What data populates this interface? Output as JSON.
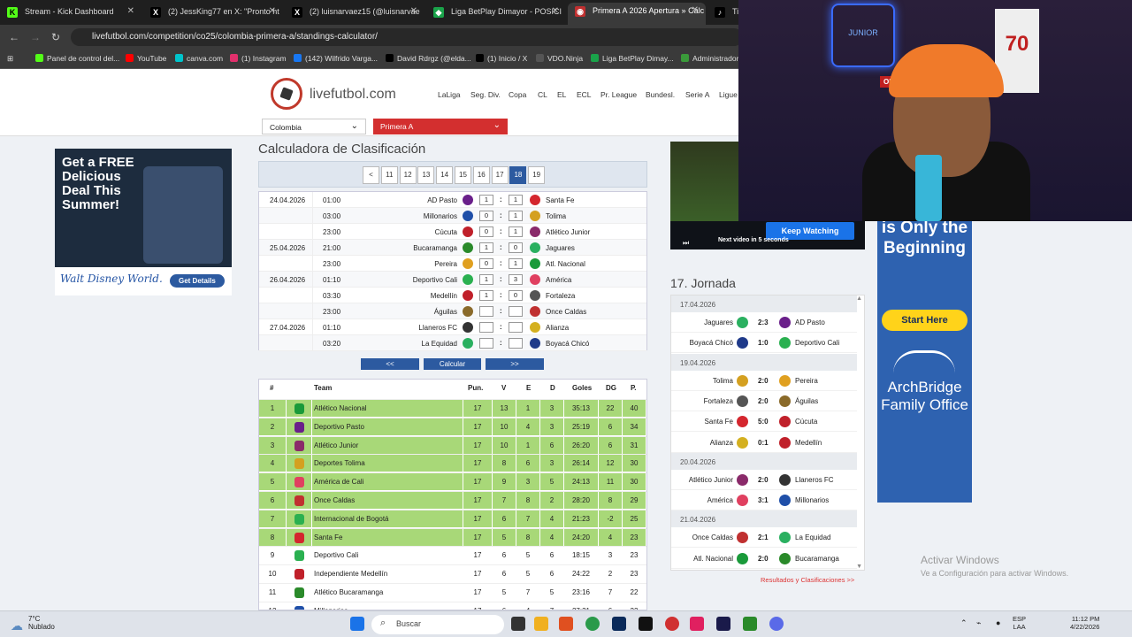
{
  "browser": {
    "tabs": [
      {
        "label": "Stream - Kick Dashboard",
        "icon": "K"
      },
      {
        "label": "(2) JessKing77 en X: \"Pronto ht",
        "icon": "X"
      },
      {
        "label": "(2) luisnarvaez15 (@luisnarvae",
        "icon": "X"
      },
      {
        "label": "Liga BetPlay Dimayor - POSICI",
        "icon": "◆"
      },
      {
        "label": "Primera A 2026 Apertura » Calc",
        "icon": "◉"
      },
      {
        "label": "Tik",
        "icon": "♪"
      }
    ],
    "url": "livefutbol.com/competition/co25/colombia-primera-a/standings-calculator/",
    "bookmarks": [
      "Panel de control del...",
      "YouTube",
      "canva.com",
      "(1) Instagram",
      "(142) Wilfrido Varga...",
      "David Rdrgz (@elda...",
      "(1) Inicio / X",
      "VDO.Ninja",
      "Liga BetPlay Dimay...",
      "Administrador"
    ]
  },
  "site": {
    "logo_text": "livefutbol.com",
    "nav": [
      "LaLiga",
      "Seg. Div.",
      "Copa",
      "CL",
      "EL",
      "ECL",
      "Pr. League",
      "Bundesl.",
      "Serie A",
      "Ligue"
    ],
    "country_select": "Colombia",
    "league_select": "Primera A"
  },
  "calculator": {
    "title": "Calculadora de Clasificación",
    "pages": [
      "<",
      "11",
      "12",
      "13",
      "14",
      "15",
      "16",
      "17",
      "18",
      "19"
    ],
    "active_page": "18",
    "matches": [
      {
        "date": "24.04.2026",
        "time": "01:00",
        "home": "AD Pasto",
        "hs": "1",
        "as": "1",
        "away": "Santa Fe",
        "hc": "#6a1f8a",
        "ac": "#d4262e"
      },
      {
        "date": "",
        "time": "03:00",
        "home": "Millonarios",
        "hs": "0",
        "as": "1",
        "away": "Tolima",
        "hc": "#1f4fa8",
        "ac": "#d4a020"
      },
      {
        "date": "",
        "time": "23:00",
        "home": "Cúcuta",
        "hs": "0",
        "as": "1",
        "away": "Atlético Junior",
        "hc": "#c0202a",
        "ac": "#8a2a6a"
      },
      {
        "date": "25.04.2026",
        "time": "21:00",
        "home": "Bucaramanga",
        "hs": "1",
        "as": "0",
        "away": "Jaguares",
        "hc": "#2a8a2a",
        "ac": "#2ab060"
      },
      {
        "date": "",
        "time": "23:00",
        "home": "Pereira",
        "hs": "0",
        "as": "1",
        "away": "Atl. Nacional",
        "hc": "#e0a020",
        "ac": "#1a9a3a"
      },
      {
        "date": "26.04.2026",
        "time": "01:10",
        "home": "Deportivo Cali",
        "hs": "1",
        "as": "3",
        "away": "América",
        "hc": "#2ab050",
        "ac": "#e04060"
      },
      {
        "date": "",
        "time": "03:30",
        "home": "Medellín",
        "hs": "1",
        "as": "0",
        "away": "Fortaleza",
        "hc": "#c0202a",
        "ac": "#555555"
      },
      {
        "date": "",
        "time": "23:00",
        "home": "Águilas",
        "hs": "",
        "as": "",
        "away": "Once Caldas",
        "hc": "#8a6a2a",
        "ac": "#c03030"
      },
      {
        "date": "27.04.2026",
        "time": "01:10",
        "home": "Llaneros FC",
        "hs": "",
        "as": "",
        "away": "Alianza",
        "hc": "#333333",
        "ac": "#d4b020"
      },
      {
        "date": "",
        "time": "03:20",
        "home": "La Equidad",
        "hs": "",
        "as": "",
        "away": "Boyacá Chicó",
        "hc": "#2ab060",
        "ac": "#1f3a8a"
      }
    ],
    "buttons": {
      "prev": "<<",
      "calc": "Calcular",
      "next": ">>"
    }
  },
  "standings": {
    "headers": {
      "pos": "#",
      "team": "Team",
      "pts": "Pun.",
      "w": "V",
      "d": "E",
      "l": "D",
      "goals": "Goles",
      "gd": "DG",
      "p": "P."
    },
    "rows": [
      {
        "pos": "1",
        "team": "Atlético Nacional",
        "pts": "17",
        "w": "13",
        "d": "1",
        "l": "3",
        "goals": "35:13",
        "gd": "22",
        "p": "40",
        "green": true,
        "color": "#1a9a3a"
      },
      {
        "pos": "2",
        "team": "Deportivo Pasto",
        "pts": "17",
        "w": "10",
        "d": "4",
        "l": "3",
        "goals": "25:19",
        "gd": "6",
        "p": "34",
        "green": true,
        "color": "#6a1f8a"
      },
      {
        "pos": "3",
        "team": "Atlético Junior",
        "pts": "17",
        "w": "10",
        "d": "1",
        "l": "6",
        "goals": "26:20",
        "gd": "6",
        "p": "31",
        "green": true,
        "color": "#8a2a6a"
      },
      {
        "pos": "4",
        "team": "Deportes Tolima",
        "pts": "17",
        "w": "8",
        "d": "6",
        "l": "3",
        "goals": "26:14",
        "gd": "12",
        "p": "30",
        "green": true,
        "color": "#d4a020"
      },
      {
        "pos": "5",
        "team": "América de Cali",
        "pts": "17",
        "w": "9",
        "d": "3",
        "l": "5",
        "goals": "24:13",
        "gd": "11",
        "p": "30",
        "green": true,
        "color": "#e04060"
      },
      {
        "pos": "6",
        "team": "Once Caldas",
        "pts": "17",
        "w": "7",
        "d": "8",
        "l": "2",
        "goals": "28:20",
        "gd": "8",
        "p": "29",
        "green": true,
        "color": "#c03030"
      },
      {
        "pos": "7",
        "team": "Internacional de Bogotá",
        "pts": "17",
        "w": "6",
        "d": "7",
        "l": "4",
        "goals": "21:23",
        "gd": "-2",
        "p": "25",
        "green": true,
        "color": "#2ab050"
      },
      {
        "pos": "8",
        "team": "Santa Fe",
        "pts": "17",
        "w": "5",
        "d": "8",
        "l": "4",
        "goals": "24:20",
        "gd": "4",
        "p": "23",
        "green": true,
        "color": "#d4262e"
      },
      {
        "pos": "9",
        "team": "Deportivo Cali",
        "pts": "17",
        "w": "6",
        "d": "5",
        "l": "6",
        "goals": "18:15",
        "gd": "3",
        "p": "23",
        "green": false,
        "color": "#2ab050"
      },
      {
        "pos": "10",
        "team": "Independiente Medellín",
        "pts": "17",
        "w": "6",
        "d": "5",
        "l": "6",
        "goals": "24:22",
        "gd": "2",
        "p": "23",
        "green": false,
        "color": "#c0202a"
      },
      {
        "pos": "11",
        "team": "Atlético Bucaramanga",
        "pts": "17",
        "w": "5",
        "d": "7",
        "l": "5",
        "goals": "23:16",
        "gd": "7",
        "p": "22",
        "green": false,
        "color": "#2a8a2a"
      },
      {
        "pos": "12",
        "team": "Millonarios",
        "pts": "17",
        "w": "6",
        "d": "4",
        "l": "7",
        "goals": "27:21",
        "gd": "6",
        "p": "22",
        "green": false,
        "color": "#1f4fa8"
      }
    ]
  },
  "video": {
    "keep_watching": "Keep Watching",
    "next_text": "Next video in 5 seconds"
  },
  "jornada": {
    "title": "17. Jornada",
    "link": "Resultados y Clasificaciones >>",
    "blocks": [
      {
        "date": "17.04.2026",
        "games": [
          {
            "home": "Jaguares",
            "score": "2:3",
            "away": "AD Pasto",
            "hc": "#2ab060",
            "ac": "#6a1f8a"
          },
          {
            "home": "Boyacá Chicó",
            "score": "1:0",
            "away": "Deportivo Cali",
            "hc": "#1f3a8a",
            "ac": "#2ab050"
          }
        ]
      },
      {
        "date": "19.04.2026",
        "games": [
          {
            "home": "Tolima",
            "score": "2:0",
            "away": "Pereira",
            "hc": "#d4a020",
            "ac": "#e0a020"
          },
          {
            "home": "Fortaleza",
            "score": "2:0",
            "away": "Águilas",
            "hc": "#555555",
            "ac": "#8a6a2a"
          },
          {
            "home": "Santa Fe",
            "score": "5:0",
            "away": "Cúcuta",
            "hc": "#d4262e",
            "ac": "#c0202a"
          },
          {
            "home": "Alianza",
            "score": "0:1",
            "away": "Medellín",
            "hc": "#d4b020",
            "ac": "#c0202a"
          }
        ]
      },
      {
        "date": "20.04.2026",
        "games": [
          {
            "home": "Atlético Junior",
            "score": "2:0",
            "away": "Llaneros FC",
            "hc": "#8a2a6a",
            "ac": "#333333"
          },
          {
            "home": "América",
            "score": "3:1",
            "away": "Millonarios",
            "hc": "#e04060",
            "ac": "#1f4fa8"
          }
        ]
      },
      {
        "date": "21.04.2026",
        "games": [
          {
            "home": "Once Caldas",
            "score": "2:1",
            "away": "La Equidad",
            "hc": "#c03030",
            "ac": "#2ab060"
          },
          {
            "home": "Atl. Nacional",
            "score": "2:0",
            "away": "Bucaramanga",
            "hc": "#1a9a3a",
            "ac": "#2a8a2a"
          }
        ]
      }
    ]
  },
  "ads": {
    "left_headline": "Get a FREE Delicious Deal This Summer!",
    "left_brand": "Walt Disney World.",
    "left_cta": "Get Details",
    "right_headline": "is Only the Beginning",
    "right_cta": "Start Here",
    "right_brand": "ArchBridge Family Office"
  },
  "activate": {
    "title": "Activar Windows",
    "sub": "Ve a Configuración para activar Windows."
  },
  "webcam": {
    "neon": "JUNIOR",
    "jersey": "70",
    "onair": "ON AIR"
  },
  "taskbar": {
    "temp": "7°C",
    "cond": "Nublado",
    "search": "Buscar",
    "lang1": "ESP",
    "lang2": "LAA",
    "time": "11:12 PM",
    "date": "4/22/2026"
  }
}
